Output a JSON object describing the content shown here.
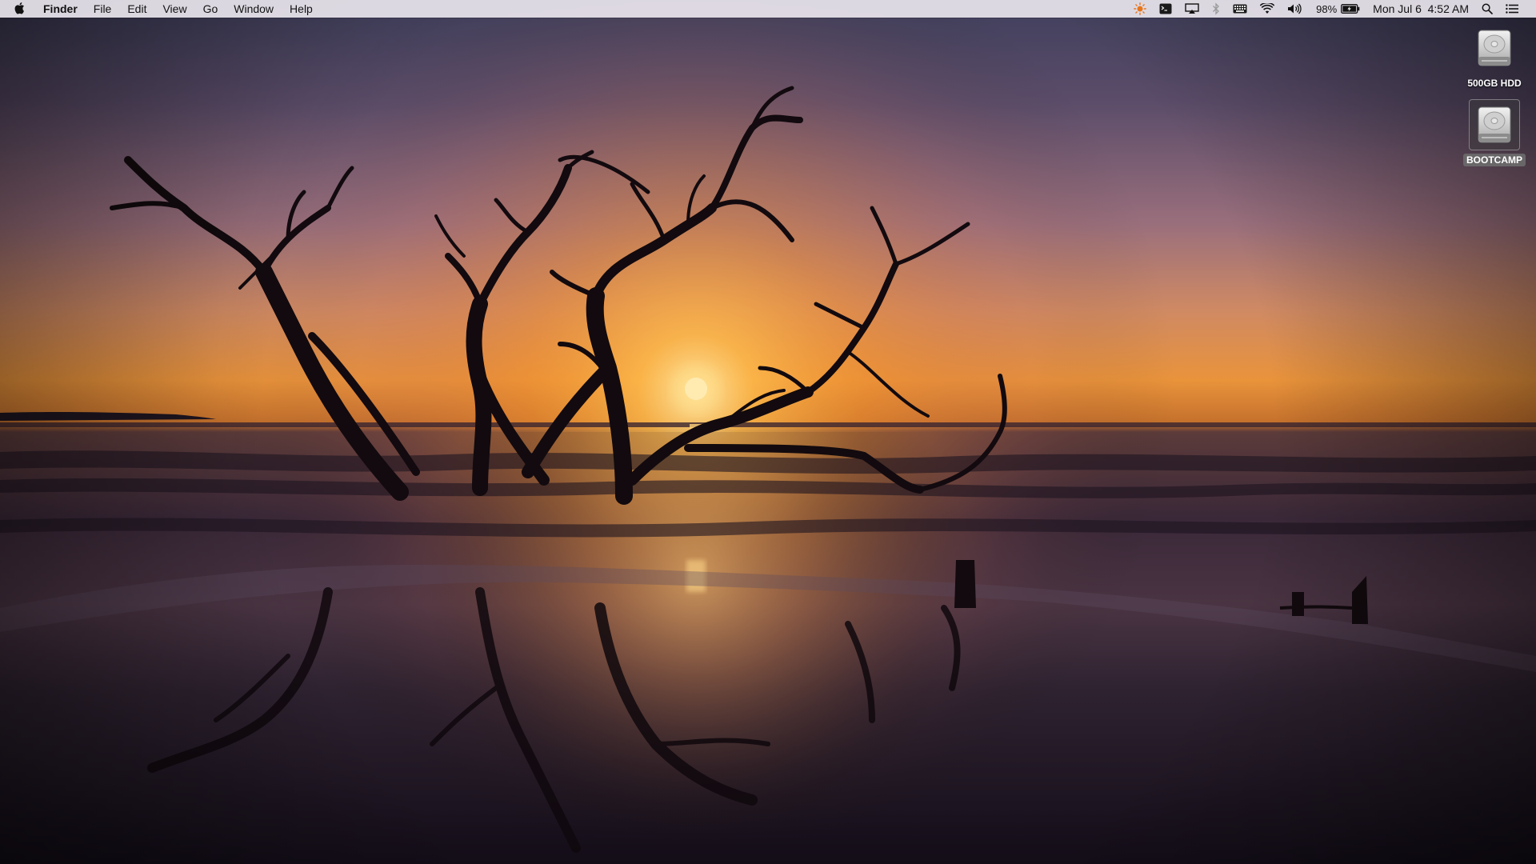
{
  "menubar": {
    "app_name": "Finder",
    "menus": [
      "File",
      "Edit",
      "View",
      "Go",
      "Window",
      "Help"
    ],
    "status_items": {
      "battery_percent": "98%",
      "clock": "Mon Jul 6  4:52 AM"
    },
    "icons": [
      "apple-icon",
      "brightness-icon",
      "terminal-icon",
      "airplay-icon",
      "bluetooth-icon",
      "keyboard-icon",
      "wifi-icon",
      "volume-icon",
      "battery-icon",
      "spotlight-icon",
      "notification-center-icon"
    ]
  },
  "desktop": {
    "drives": [
      {
        "label": "500GB HDD",
        "selected": false
      },
      {
        "label": "BOOTCAMP",
        "selected": true
      }
    ]
  },
  "wallpaper": {
    "subject": "driftwood-tree-sunrise-beach",
    "colors": {
      "sky_top": "#5a4a6a",
      "sky_glow": "#f3a13a",
      "sun": "#fff3c8",
      "water": "#2a1e2e"
    }
  }
}
